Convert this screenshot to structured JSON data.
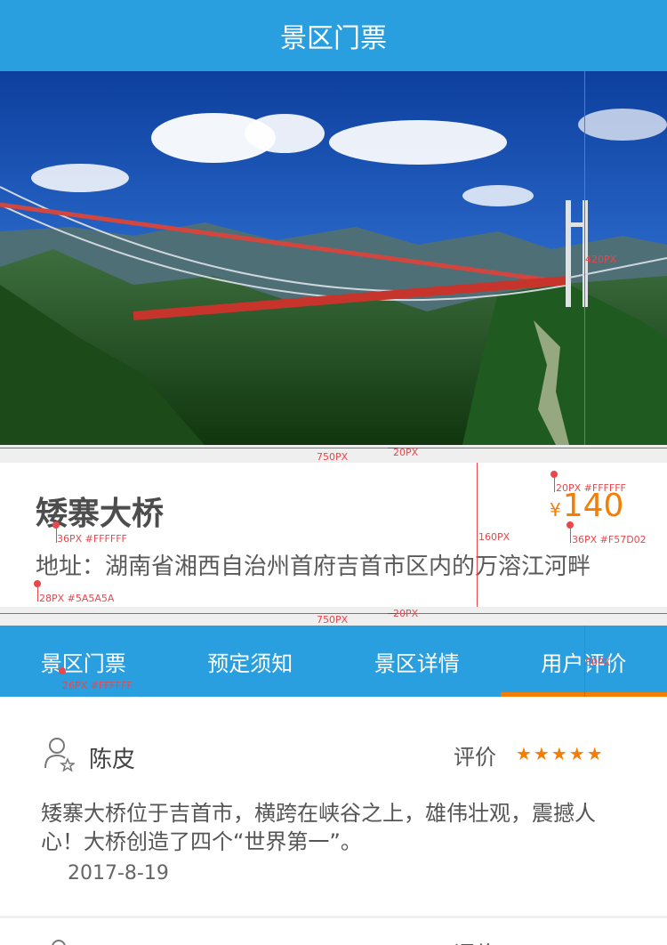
{
  "header": {
    "title": "景区门票"
  },
  "hero": {
    "image_label": "bridge-landscape-photo"
  },
  "spot": {
    "name": "矮寨大桥",
    "address": "地址：湖南省湘西自治州首府吉首市区内的万溶江河畔",
    "price_symbol": "¥",
    "price": "140"
  },
  "annotations": {
    "hero_height": "420PX",
    "width_top": "750PX",
    "gap_top": "20PX",
    "title_spec": "36PX #FFFFFF",
    "address_spec": "28PX #5A5A5A",
    "info_height": "160PX",
    "symbol_spec": "20PX #FFFFFF",
    "price_spec": "36PX #F57D02",
    "width_bottom": "750PX",
    "gap_bottom": "20PX",
    "tab_spec": "26PX #FFFFFF",
    "tab_height": "80PX"
  },
  "tabs": [
    {
      "label": "景区门票"
    },
    {
      "label": "预定须知"
    },
    {
      "label": "景区详情"
    },
    {
      "label": "用户评价"
    }
  ],
  "reviews": [
    {
      "user": "陈皮",
      "rate_label": "评价",
      "stars": "★★★★★",
      "text": "矮寨大桥位于吉首市，横跨在峡谷之上，雄伟壮观，震撼人心！大桥创造了四个“世界第一”。",
      "date": "2017-8-19"
    },
    {
      "rate_label": "评价"
    }
  ],
  "colors": {
    "primary": "#2A9FE0",
    "accent": "#F57D02",
    "annotation": "#E8474C"
  }
}
